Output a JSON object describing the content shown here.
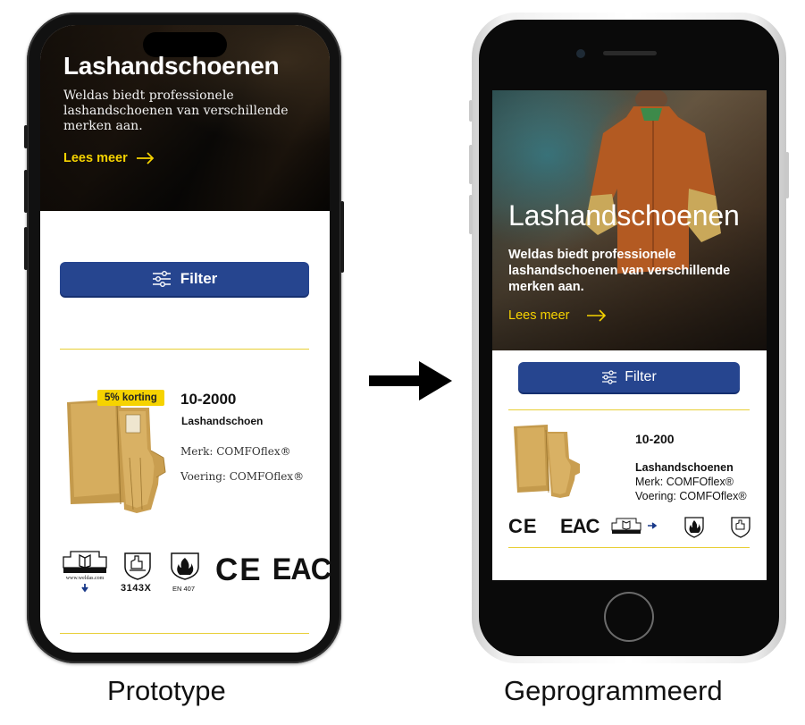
{
  "prototype": {
    "caption": "Prototype",
    "hero": {
      "title": "Lashandschoenen",
      "description": "Weldas biedt professionele lashandschoenen van verschillende merken aan.",
      "link": "Lees meer"
    },
    "filter_label": "Filter",
    "product": {
      "badge": "5% korting",
      "code": "10-2000",
      "type": "Lashandschoen",
      "brand": "Merk: COMFOflex®",
      "lining": "Voering: COMFOflex®"
    },
    "icons": {
      "manual_text": "www.weldas.com",
      "norm_code": "3143X",
      "flame_code": "EN 407",
      "ce": "CE",
      "eac": "EAC"
    }
  },
  "programmed": {
    "caption": "Geprogrammeerd",
    "hero": {
      "title": "Lashandschoenen",
      "description": "Weldas biedt professionele lashandschoenen van verschillende merken aan.",
      "link": "Lees meer"
    },
    "filter_label": "Filter",
    "product": {
      "code": "10-200",
      "type": "Lashandschoenen",
      "brand": "Merk: COMFOflex®",
      "lining": "Voering: COMFOflex®"
    },
    "icons": {
      "ce": "CE",
      "eac": "EAC"
    }
  },
  "colors": {
    "accent_yellow": "#f6d300",
    "filter_blue": "#26458f"
  }
}
